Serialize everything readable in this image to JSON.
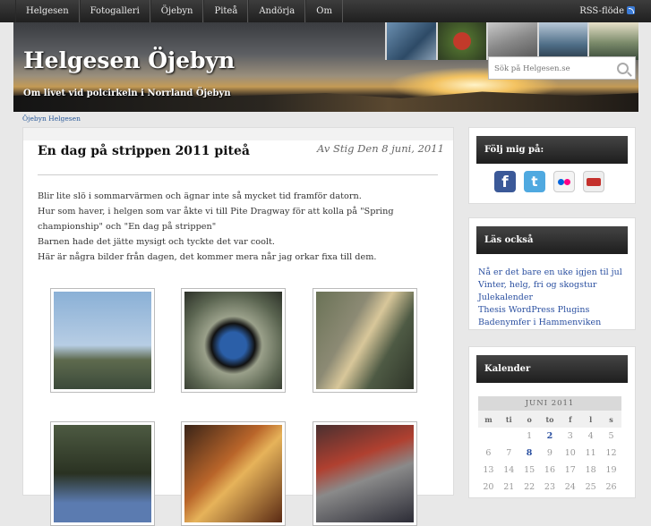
{
  "nav": {
    "items": [
      "Helgesen",
      "Fotogalleri",
      "Öjebyn",
      "Piteå",
      "Andörja",
      "Om"
    ],
    "rss_label": "RSS-flöde"
  },
  "header": {
    "site_title": "Helgesen Öjebyn",
    "tagline": "Om livet vid polcirkeln i Norrland Öjebyn",
    "search_placeholder": "Sök på Helgesen.se"
  },
  "breadcrumb": "Öjebyn Helgesen",
  "post": {
    "title": "En dag på strippen 2011 piteå",
    "byline": "Av Stig Den 8 juni, 2011",
    "paragraphs": [
      "Blir lite slö i sommarvärmen och ägnar inte så mycket tid framför datorn.",
      "Hur som haver, i helgen som var åkte vi till Pite Dragway för att kolla på \"Spring championship\" och \"En dag på strippen\"",
      "Barnen hade det jätte mysigt och tyckte det var coolt.",
      "Här är några bilder från dagen, det kommer mera når jag orkar fixa till dem."
    ]
  },
  "sidebar": {
    "follow_title": "Följ mig på:",
    "social": [
      "facebook-icon",
      "twitter-icon",
      "flickr-icon",
      "youtube-icon"
    ],
    "read_title": "Läs också",
    "read_links": [
      "Nå er det bare en uke igjen til jul",
      "Vinter, helg, fri og skogstur",
      "Julekalender",
      "Thesis WordPress Plugins",
      "Badenymfer i Hammenviken"
    ],
    "calendar_title": "Kalender",
    "calendar": {
      "month": "JUNI 2011",
      "weekdays": [
        "m",
        "ti",
        "o",
        "to",
        "f",
        "l",
        "s"
      ],
      "rows": [
        [
          "",
          "",
          "1",
          "2",
          "3",
          "4",
          "5"
        ],
        [
          "6",
          "7",
          "8",
          "9",
          "10",
          "11",
          "12"
        ],
        [
          "13",
          "14",
          "15",
          "16",
          "17",
          "18",
          "19"
        ],
        [
          "20",
          "21",
          "22",
          "23",
          "24",
          "25",
          "26"
        ]
      ],
      "linked_days": [
        "2",
        "8"
      ]
    }
  }
}
